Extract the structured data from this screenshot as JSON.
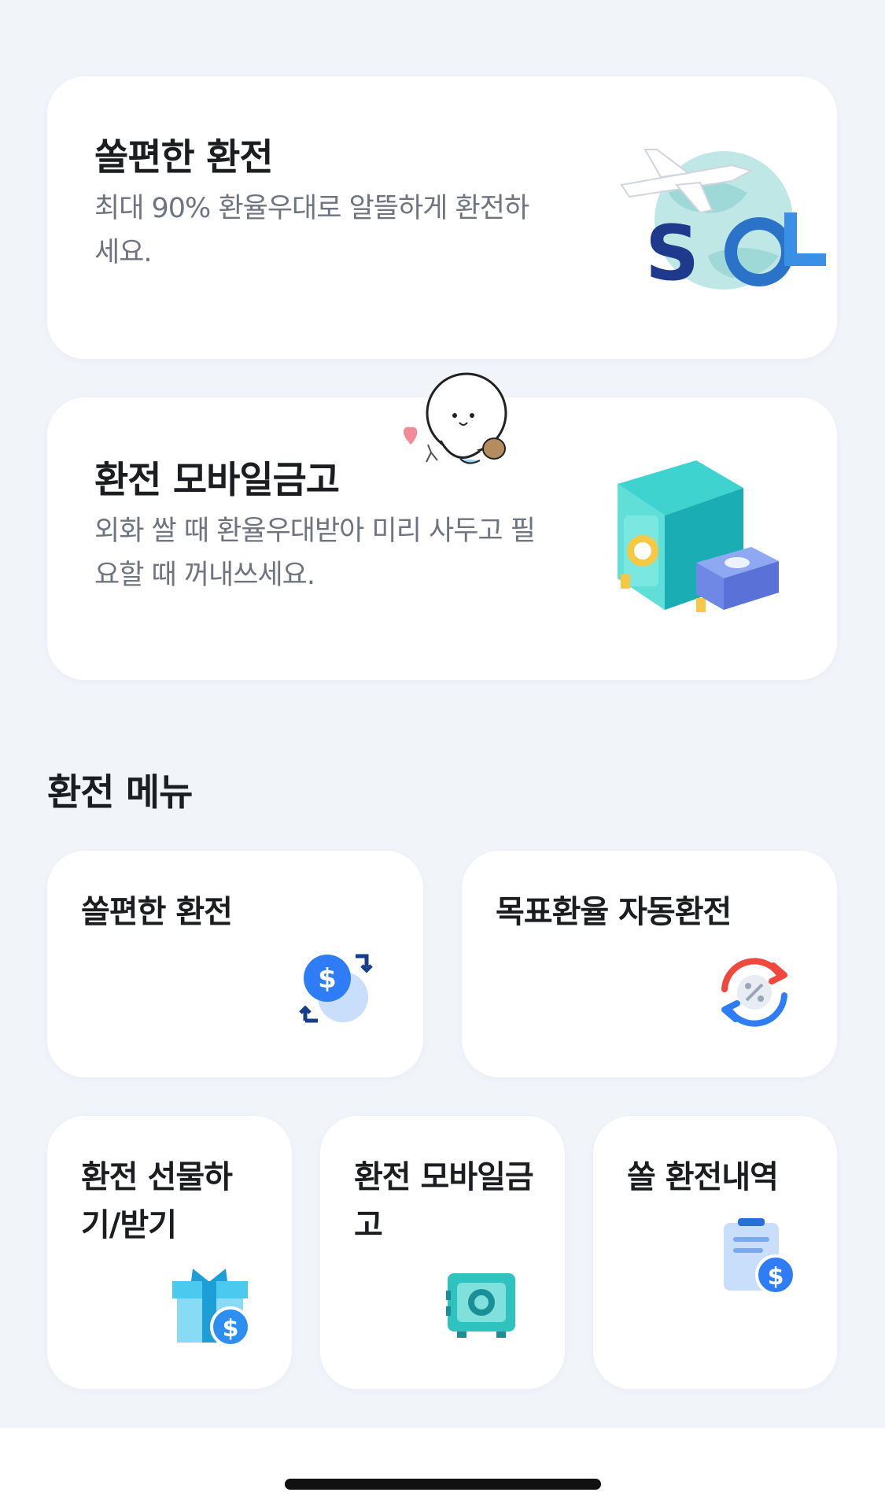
{
  "banners": [
    {
      "title": "쏠편한 환전",
      "description": "최대 90% 환율우대로 알뜰하게 환전하세요.",
      "icon": "sol-globe-airplane-icon"
    },
    {
      "title": "환전 모바일금고",
      "description": "외화 쌀 때 환율우대받아 미리 사두고 필요할 때 꺼내쓰세요.",
      "icon": "safe-with-money-icon",
      "mascot": "seal-mascot-icon"
    }
  ],
  "section": {
    "title": "환전 메뉴"
  },
  "menu": [
    {
      "label": "쏠편한 환전",
      "icon": "currency-exchange-icon"
    },
    {
      "label": "목표환율 자동환전",
      "icon": "auto-exchange-rate-icon"
    },
    {
      "label": "환전 선물하기/받기",
      "icon": "gift-dollar-icon"
    },
    {
      "label": "환전 모바일금고",
      "icon": "safe-icon"
    },
    {
      "label": "쏠 환전내역",
      "icon": "clipboard-dollar-icon"
    }
  ],
  "colors": {
    "background": "#f1f5fa",
    "card": "#ffffff",
    "accent_blue": "#2f7df6",
    "teal": "#2fc3c0",
    "red": "#f0483e"
  }
}
